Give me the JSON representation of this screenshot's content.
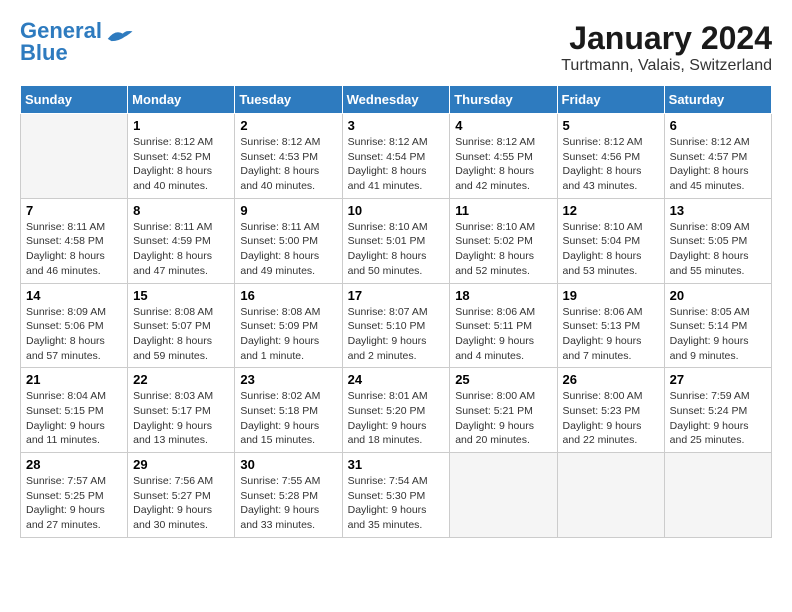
{
  "logo": {
    "line1": "General",
    "line2": "Blue"
  },
  "title": "January 2024",
  "subtitle": "Turtmann, Valais, Switzerland",
  "days_of_week": [
    "Sunday",
    "Monday",
    "Tuesday",
    "Wednesday",
    "Thursday",
    "Friday",
    "Saturday"
  ],
  "weeks": [
    [
      {
        "day": "",
        "sunrise": "",
        "sunset": "",
        "daylight": ""
      },
      {
        "day": "1",
        "sunrise": "8:12 AM",
        "sunset": "4:52 PM",
        "daylight": "8 hours and 40 minutes."
      },
      {
        "day": "2",
        "sunrise": "8:12 AM",
        "sunset": "4:53 PM",
        "daylight": "8 hours and 40 minutes."
      },
      {
        "day": "3",
        "sunrise": "8:12 AM",
        "sunset": "4:54 PM",
        "daylight": "8 hours and 41 minutes."
      },
      {
        "day": "4",
        "sunrise": "8:12 AM",
        "sunset": "4:55 PM",
        "daylight": "8 hours and 42 minutes."
      },
      {
        "day": "5",
        "sunrise": "8:12 AM",
        "sunset": "4:56 PM",
        "daylight": "8 hours and 43 minutes."
      },
      {
        "day": "6",
        "sunrise": "8:12 AM",
        "sunset": "4:57 PM",
        "daylight": "8 hours and 45 minutes."
      }
    ],
    [
      {
        "day": "7",
        "sunrise": "8:11 AM",
        "sunset": "4:58 PM",
        "daylight": "8 hours and 46 minutes."
      },
      {
        "day": "8",
        "sunrise": "8:11 AM",
        "sunset": "4:59 PM",
        "daylight": "8 hours and 47 minutes."
      },
      {
        "day": "9",
        "sunrise": "8:11 AM",
        "sunset": "5:00 PM",
        "daylight": "8 hours and 49 minutes."
      },
      {
        "day": "10",
        "sunrise": "8:10 AM",
        "sunset": "5:01 PM",
        "daylight": "8 hours and 50 minutes."
      },
      {
        "day": "11",
        "sunrise": "8:10 AM",
        "sunset": "5:02 PM",
        "daylight": "8 hours and 52 minutes."
      },
      {
        "day": "12",
        "sunrise": "8:10 AM",
        "sunset": "5:04 PM",
        "daylight": "8 hours and 53 minutes."
      },
      {
        "day": "13",
        "sunrise": "8:09 AM",
        "sunset": "5:05 PM",
        "daylight": "8 hours and 55 minutes."
      }
    ],
    [
      {
        "day": "14",
        "sunrise": "8:09 AM",
        "sunset": "5:06 PM",
        "daylight": "8 hours and 57 minutes."
      },
      {
        "day": "15",
        "sunrise": "8:08 AM",
        "sunset": "5:07 PM",
        "daylight": "8 hours and 59 minutes."
      },
      {
        "day": "16",
        "sunrise": "8:08 AM",
        "sunset": "5:09 PM",
        "daylight": "9 hours and 1 minute."
      },
      {
        "day": "17",
        "sunrise": "8:07 AM",
        "sunset": "5:10 PM",
        "daylight": "9 hours and 2 minutes."
      },
      {
        "day": "18",
        "sunrise": "8:06 AM",
        "sunset": "5:11 PM",
        "daylight": "9 hours and 4 minutes."
      },
      {
        "day": "19",
        "sunrise": "8:06 AM",
        "sunset": "5:13 PM",
        "daylight": "9 hours and 7 minutes."
      },
      {
        "day": "20",
        "sunrise": "8:05 AM",
        "sunset": "5:14 PM",
        "daylight": "9 hours and 9 minutes."
      }
    ],
    [
      {
        "day": "21",
        "sunrise": "8:04 AM",
        "sunset": "5:15 PM",
        "daylight": "9 hours and 11 minutes."
      },
      {
        "day": "22",
        "sunrise": "8:03 AM",
        "sunset": "5:17 PM",
        "daylight": "9 hours and 13 minutes."
      },
      {
        "day": "23",
        "sunrise": "8:02 AM",
        "sunset": "5:18 PM",
        "daylight": "9 hours and 15 minutes."
      },
      {
        "day": "24",
        "sunrise": "8:01 AM",
        "sunset": "5:20 PM",
        "daylight": "9 hours and 18 minutes."
      },
      {
        "day": "25",
        "sunrise": "8:00 AM",
        "sunset": "5:21 PM",
        "daylight": "9 hours and 20 minutes."
      },
      {
        "day": "26",
        "sunrise": "8:00 AM",
        "sunset": "5:23 PM",
        "daylight": "9 hours and 22 minutes."
      },
      {
        "day": "27",
        "sunrise": "7:59 AM",
        "sunset": "5:24 PM",
        "daylight": "9 hours and 25 minutes."
      }
    ],
    [
      {
        "day": "28",
        "sunrise": "7:57 AM",
        "sunset": "5:25 PM",
        "daylight": "9 hours and 27 minutes."
      },
      {
        "day": "29",
        "sunrise": "7:56 AM",
        "sunset": "5:27 PM",
        "daylight": "9 hours and 30 minutes."
      },
      {
        "day": "30",
        "sunrise": "7:55 AM",
        "sunset": "5:28 PM",
        "daylight": "9 hours and 33 minutes."
      },
      {
        "day": "31",
        "sunrise": "7:54 AM",
        "sunset": "5:30 PM",
        "daylight": "9 hours and 35 minutes."
      },
      {
        "day": "",
        "sunrise": "",
        "sunset": "",
        "daylight": ""
      },
      {
        "day": "",
        "sunrise": "",
        "sunset": "",
        "daylight": ""
      },
      {
        "day": "",
        "sunrise": "",
        "sunset": "",
        "daylight": ""
      }
    ]
  ]
}
